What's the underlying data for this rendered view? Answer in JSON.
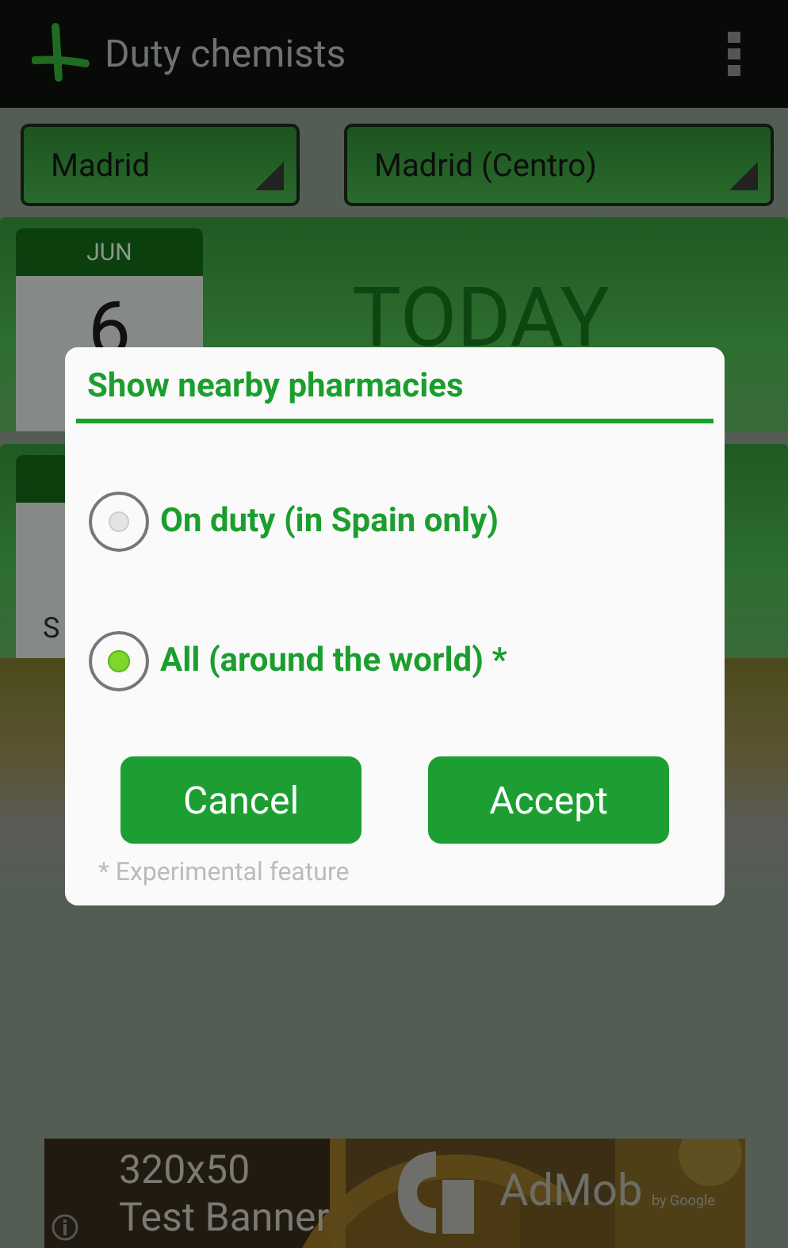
{
  "action_bar": {
    "title": "Duty chemists"
  },
  "spinners": [
    {
      "value": "Madrid"
    },
    {
      "value": "Madrid (Centro)"
    }
  ],
  "today_card": {
    "month": "JUN",
    "day": "6",
    "label": "TODAY"
  },
  "next_card": {
    "text": "S"
  },
  "dialog": {
    "title": "Show nearby pharmacies",
    "options": [
      {
        "label": "On duty (in Spain only)",
        "selected": false
      },
      {
        "label": "All (around the world) *",
        "selected": true
      }
    ],
    "buttons": [
      "Cancel",
      "Accept"
    ],
    "footnote": "* Experimental feature"
  },
  "ad_banner": {
    "size": "320x50",
    "text": "Test Banner",
    "brand": "AdMob",
    "byline": "by Google"
  }
}
